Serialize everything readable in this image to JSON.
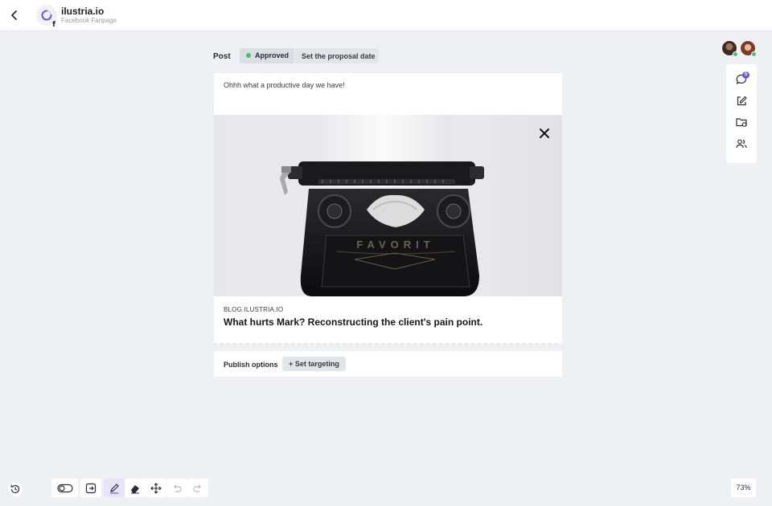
{
  "header": {
    "back_icon": "chevron-left-icon",
    "brand_name": "ilustria.io",
    "brand_subtitle": "Facebook Fanpage",
    "brand_badge": "f"
  },
  "post": {
    "label": "Post",
    "status": "Approved",
    "status_color": "#44c16a",
    "proposal_button": "Set the proposal date",
    "text": "Ohhh what a productive day we have!",
    "link_domain": "BLOG.ILUSTRIA.IO",
    "link_title": "What hurts Mark? Reconstructing the client's pain point.",
    "image_lettering": "FAVORIT"
  },
  "publish": {
    "label": "Publish options",
    "targeting_button": "+ Set targeting"
  },
  "side_tools": {
    "comments_badge": "5",
    "icons": [
      "comment-icon",
      "edit-icon",
      "folder-settings-icon",
      "users-icon"
    ]
  },
  "bottom_tools": {
    "icons": [
      "toggle-icon",
      "export-icon",
      "pen-icon",
      "eraser-icon",
      "move-icon",
      "undo-icon",
      "redo-icon"
    ]
  },
  "zoom_level": "73%",
  "colors": {
    "accent": "#6a5ae0",
    "online": "#44c16a",
    "background": "#eff0f3"
  }
}
